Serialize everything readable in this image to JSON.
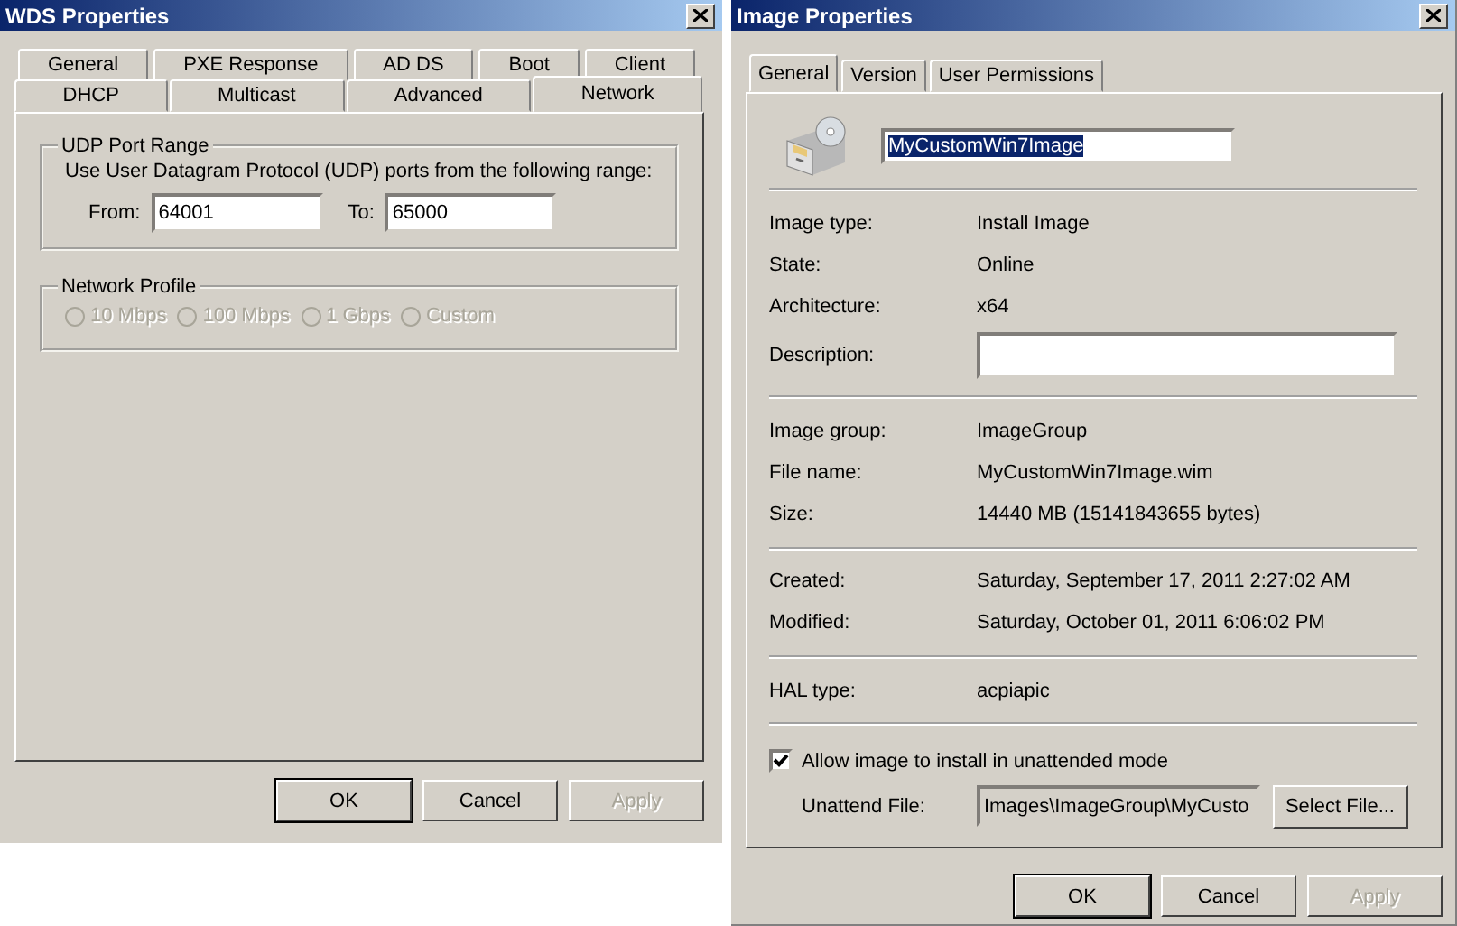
{
  "wds_properties": {
    "title": "WDS Properties",
    "tab_rows": [
      [
        {
          "label": "General",
          "selected": false
        },
        {
          "label": "PXE Response",
          "selected": false
        },
        {
          "label": "AD DS",
          "selected": false
        },
        {
          "label": "Boot",
          "selected": false
        },
        {
          "label": "Client",
          "selected": false
        }
      ],
      [
        {
          "label": "DHCP",
          "selected": false
        },
        {
          "label": "Multicast",
          "selected": false
        },
        {
          "label": "Advanced",
          "selected": false
        },
        {
          "label": "Network",
          "selected": true
        }
      ]
    ],
    "udp_group": {
      "title": "UDP Port Range",
      "description": "Use User Datagram Protocol (UDP) ports from the following range:",
      "from_label": "From:",
      "from_value": "64001",
      "to_label": "To:",
      "to_value": "65000"
    },
    "network_profile": {
      "title": "Network Profile",
      "options": [
        {
          "label": "10 Mbps",
          "selected": false,
          "disabled": true
        },
        {
          "label": "100 Mbps",
          "selected": false,
          "disabled": true
        },
        {
          "label": "1 Gbps",
          "selected": false,
          "disabled": true
        },
        {
          "label": "Custom",
          "selected": false,
          "disabled": true
        }
      ]
    },
    "buttons": [
      {
        "label": "OK",
        "default": true,
        "disabled": false
      },
      {
        "label": "Cancel",
        "default": false,
        "disabled": false
      },
      {
        "label": "Apply",
        "default": false,
        "disabled": true
      }
    ]
  },
  "image_properties": {
    "title": "Image Properties",
    "tabs": [
      {
        "label": "General",
        "selected": true
      },
      {
        "label": "Version",
        "selected": false
      },
      {
        "label": "User Permissions",
        "selected": false
      }
    ],
    "name_field": {
      "value": "MyCustomWin7Image",
      "text_selected": true
    },
    "sections": [
      [
        {
          "kind": "text",
          "label": "Image type:",
          "value": "Install Image"
        },
        {
          "kind": "text",
          "label": "State:",
          "value": "Online"
        },
        {
          "kind": "text",
          "label": "Architecture:",
          "value": "x64"
        },
        {
          "kind": "field",
          "label": "Description:"
        }
      ],
      [
        {
          "kind": "text",
          "label": "Image group:",
          "value": "ImageGroup"
        },
        {
          "kind": "text",
          "label": "File name:",
          "value": "MyCustomWin7Image.wim"
        },
        {
          "kind": "text",
          "label": "Size:",
          "value": "14440 MB (15141843655 bytes)"
        }
      ],
      [
        {
          "kind": "text",
          "label": "Created:",
          "value": "Saturday, September 17, 2011 2:27:02 AM"
        },
        {
          "kind": "text",
          "label": "Modified:",
          "value": "Saturday, October 01, 2011 6:06:02 PM"
        }
      ],
      [
        {
          "kind": "text",
          "label": "HAL type:",
          "value": "acpiapic"
        }
      ]
    ],
    "unattended": {
      "label": "Allow image to install in unattended mode",
      "checked": true,
      "file_label": "Unattend File:",
      "file_value": "Images\\ImageGroup\\MyCusto",
      "select_button": "Select File..."
    },
    "buttons": [
      {
        "label": "OK",
        "default": true,
        "disabled": false
      },
      {
        "label": "Cancel",
        "default": false,
        "disabled": false
      },
      {
        "label": "Apply",
        "default": false,
        "disabled": true
      }
    ]
  }
}
